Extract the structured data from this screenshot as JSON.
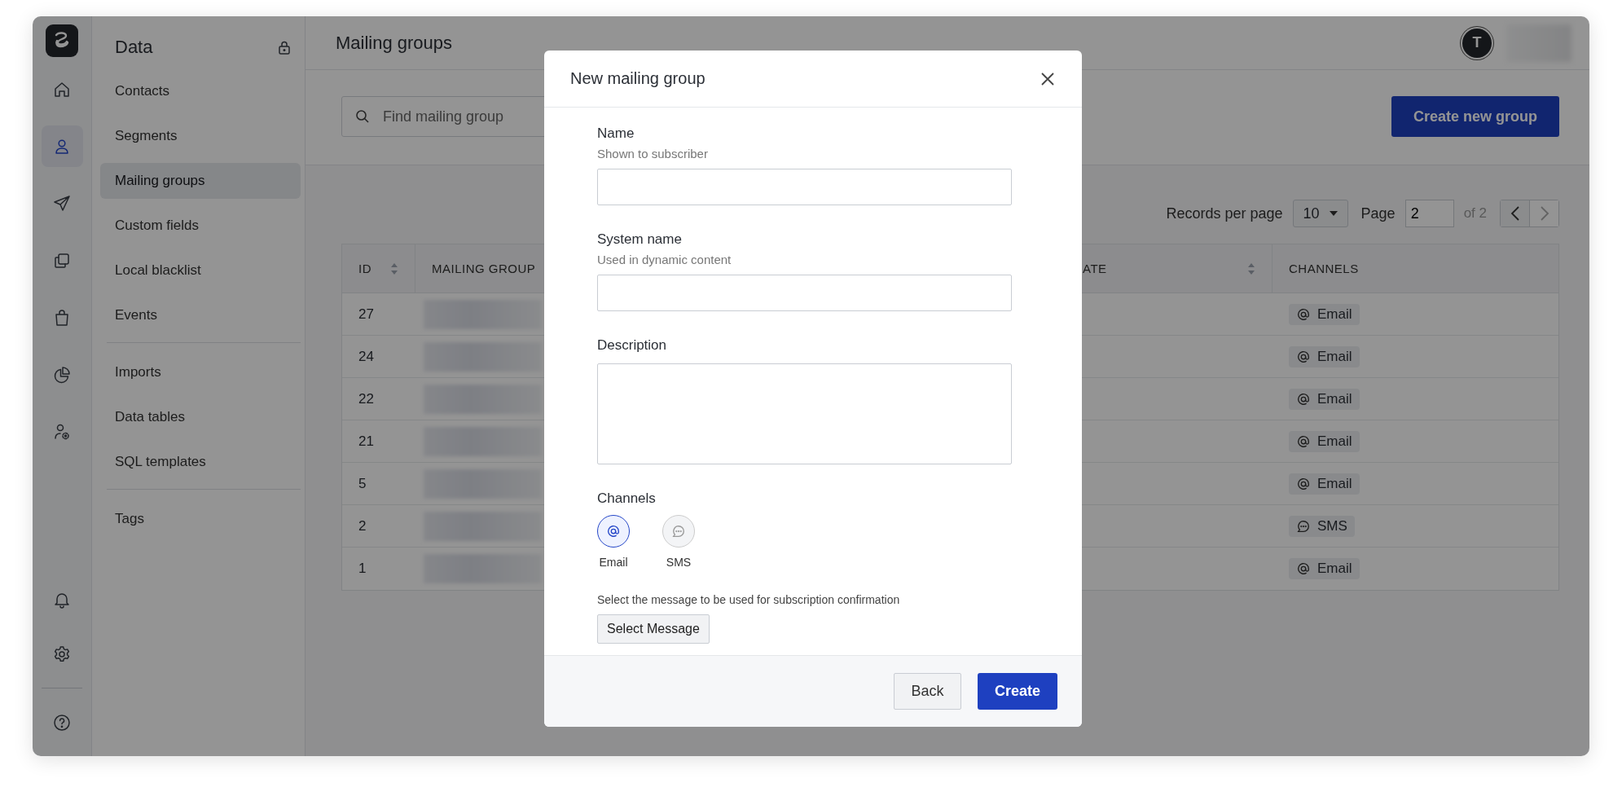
{
  "rail": {
    "items": [
      {
        "kind": "home",
        "selected": false
      },
      {
        "kind": "person",
        "selected": true
      },
      {
        "kind": "send",
        "selected": false
      },
      {
        "kind": "copy",
        "selected": false
      },
      {
        "kind": "bag",
        "selected": false
      },
      {
        "kind": "pie",
        "selected": false
      },
      {
        "kind": "user-gear",
        "selected": false
      }
    ],
    "bottom_items": [
      {
        "kind": "bell",
        "selected": false
      },
      {
        "kind": "gear",
        "selected": false
      },
      {
        "kind": "help",
        "selected": false
      }
    ]
  },
  "sidebar": {
    "title": "Data",
    "groups": [
      {
        "items": [
          {
            "label": "Contacts",
            "selected": false
          },
          {
            "label": "Segments",
            "selected": false
          },
          {
            "label": "Mailing groups",
            "selected": true
          },
          {
            "label": "Custom fields",
            "selected": false
          },
          {
            "label": "Local blacklist",
            "selected": false
          },
          {
            "label": "Events",
            "selected": false
          }
        ]
      },
      {
        "items": [
          {
            "label": "Imports",
            "selected": false
          },
          {
            "label": "Data tables",
            "selected": false
          },
          {
            "label": "SQL templates",
            "selected": false
          }
        ]
      },
      {
        "items": [
          {
            "label": "Tags",
            "selected": false
          }
        ]
      }
    ]
  },
  "header": {
    "title": "Mailing groups",
    "avatar_initial": "T"
  },
  "toolbar": {
    "search": {
      "placeholder": "Find mailing group"
    },
    "create_button": "Create new group"
  },
  "pagination": {
    "records_label": "Records per page",
    "per_page": "10",
    "page_label": "Page",
    "page": "2",
    "of": "of 2"
  },
  "table": {
    "columns": [
      {
        "label": "ID",
        "sortable": true
      },
      {
        "label": "MAILING GROUP",
        "sortable": false
      },
      {
        "label": "ATE",
        "sortable": true
      },
      {
        "label": "CHANNELS",
        "sortable": false
      }
    ],
    "rows": [
      {
        "id": "27",
        "channel": {
          "kind": "email",
          "label": "Email"
        }
      },
      {
        "id": "24",
        "channel": {
          "kind": "email",
          "label": "Email"
        }
      },
      {
        "id": "22",
        "channel": {
          "kind": "email",
          "label": "Email"
        }
      },
      {
        "id": "21",
        "channel": {
          "kind": "email",
          "label": "Email"
        }
      },
      {
        "id": "5",
        "channel": {
          "kind": "email",
          "label": "Email"
        }
      },
      {
        "id": "2",
        "channel": {
          "kind": "sms",
          "label": "SMS"
        }
      },
      {
        "id": "1",
        "channel": {
          "kind": "email",
          "label": "Email"
        }
      }
    ]
  },
  "modal": {
    "title": "New mailing group",
    "fields": [
      {
        "kind": "input",
        "label": "Name",
        "hint": "Shown to subscriber"
      },
      {
        "kind": "input",
        "label": "System name",
        "hint": "Used in dynamic content"
      },
      {
        "kind": "textarea",
        "label": "Description"
      }
    ],
    "channels_label": "Channels",
    "channels": [
      {
        "kind": "email",
        "label": "Email",
        "selected": true
      },
      {
        "kind": "sms",
        "label": "SMS",
        "selected": false
      }
    ],
    "confirmation_text": "Select the message to be used for subscription confirmation",
    "select_button": "Select Message",
    "buttons": [
      {
        "kind": "secondary",
        "label": "Back"
      },
      {
        "kind": "primary",
        "label": "Create"
      }
    ]
  }
}
